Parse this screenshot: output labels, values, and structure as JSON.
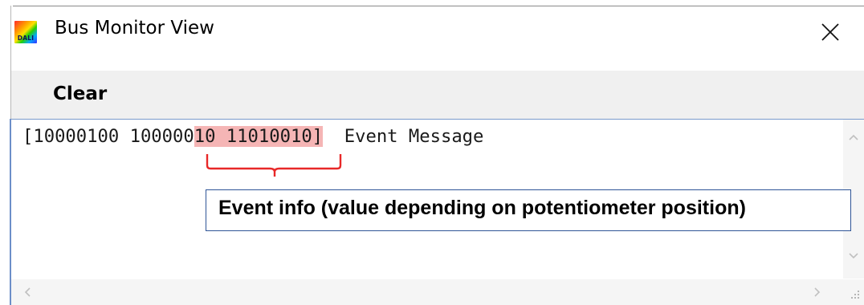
{
  "window": {
    "title": "Bus Monitor View",
    "icon_name": "dali-app-icon",
    "icon_text": "DALI"
  },
  "toolbar": {
    "clear_label": "Clear"
  },
  "log": {
    "line_prefix": "[10000100 100000",
    "line_highlight": "10 11010010]",
    "line_suffix": "  Event Message"
  },
  "annotation": {
    "callout_text": "Event info (value depending on potentiometer position)",
    "highlight_color": "#f5b5b5",
    "bracket_color": "#e82828",
    "callout_border_color": "#2f5597"
  },
  "scrollbars": {
    "up_icon": "chevron-up-icon",
    "down_icon": "chevron-down-icon",
    "left_icon": "chevron-left-icon",
    "right_icon": "chevron-right-icon",
    "grip_icon": "resize-grip-icon"
  }
}
